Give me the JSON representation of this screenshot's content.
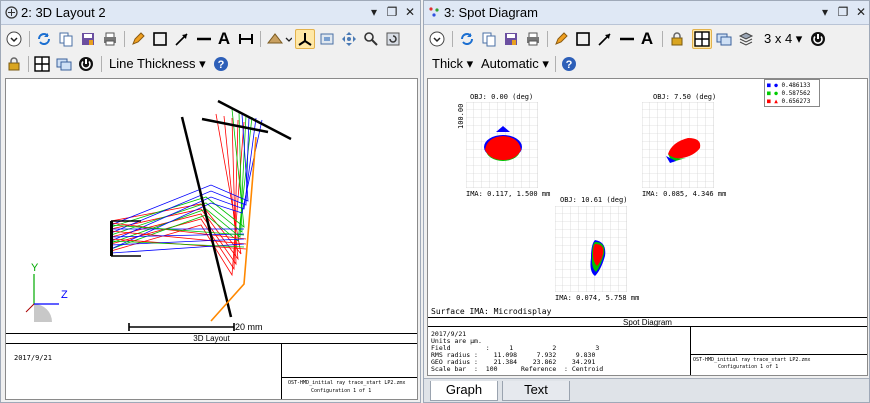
{
  "left_window": {
    "title": "2: 3D Layout 2",
    "line_thickness_label": "Line Thickness",
    "scale_bar_label": "20 mm",
    "footer_title": "3D Layout",
    "date": "2017/9/21",
    "file_line1": "OST-HMD_initial ray trace_start LP2.zmx",
    "file_line2": "Configuration 1 of 1",
    "axis_y": "Y",
    "axis_z": "Z"
  },
  "right_window": {
    "title": "3: Spot Diagram",
    "thick_label": "Thick",
    "automatic_label": "Automatic",
    "grid_label": "3 x 4",
    "legend": [
      {
        "value": "0.486133",
        "color": "#0000ff"
      },
      {
        "value": "0.587562",
        "color": "#00cc00"
      },
      {
        "value": "0.656273",
        "color": "#ff0000"
      }
    ],
    "spots": [
      {
        "obj": "OBJ: 0.00 (deg)",
        "ima": "IMA: 0.117, 1.500 mm"
      },
      {
        "obj": "OBJ: 7.50 (deg)",
        "ima": "IMA: 0.085, 4.346 mm"
      },
      {
        "obj": "OBJ: 10.61 (deg)",
        "ima": "IMA: 0.074, 5.758 mm"
      }
    ],
    "scale_label": "100.00",
    "surface_label": "Surface IMA: Microdisplay",
    "footer_title": "Spot Diagram",
    "date": "2017/9/21",
    "units": "Units are µm.",
    "field_row": "Field         :     1          2          3",
    "rms_row": "RMS radius :    11.098     7.932     9.830",
    "geo_row": "GEO radius :    21.384    23.862    34.291",
    "scale_row": "Scale bar  :  100      Reference  : Centroid",
    "file_line1": "OST-HMD_initial ray trace_start LP2.zmx",
    "file_line2": "Configuration 1 of 1",
    "tabs": [
      "Graph",
      "Text"
    ]
  }
}
